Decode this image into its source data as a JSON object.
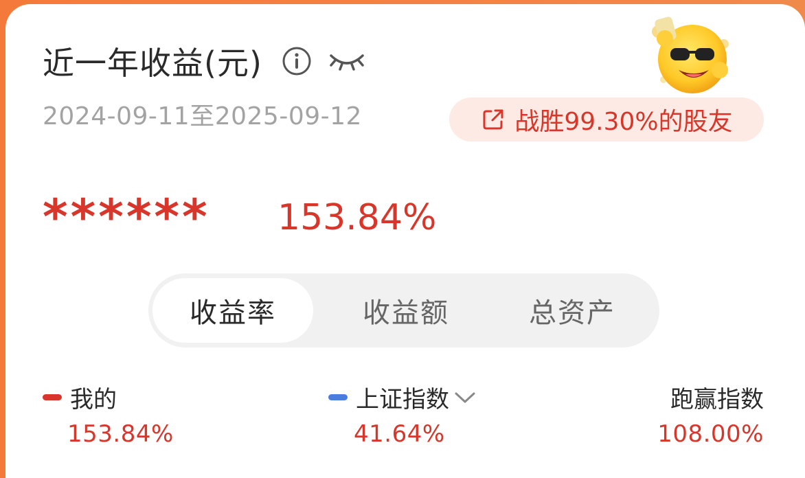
{
  "header": {
    "title": "近一年收益(元)",
    "date_range": "2024-09-11至2025-09-12"
  },
  "badge": {
    "label": "战胜99.30%的股友"
  },
  "summary": {
    "hidden_amount": "******",
    "return_rate": "153.84%"
  },
  "tabs": [
    {
      "label": "收益率",
      "active": true
    },
    {
      "label": "收益额",
      "active": false
    },
    {
      "label": "总资产",
      "active": false
    }
  ],
  "comparison": {
    "mine": {
      "label": "我的",
      "value": "153.84%",
      "color": "#d8362a"
    },
    "index": {
      "label": "上证指数",
      "value": "41.64%",
      "color": "#4a7de0"
    },
    "beat": {
      "label": "跑赢指数",
      "value": "108.00%"
    }
  },
  "colors": {
    "accent_red": "#d8362a",
    "header_orange": "#f47a3c"
  },
  "icons": [
    "info-icon",
    "eye-closed-icon",
    "share-icon",
    "chevron-down-icon",
    "mascot-emoji"
  ]
}
